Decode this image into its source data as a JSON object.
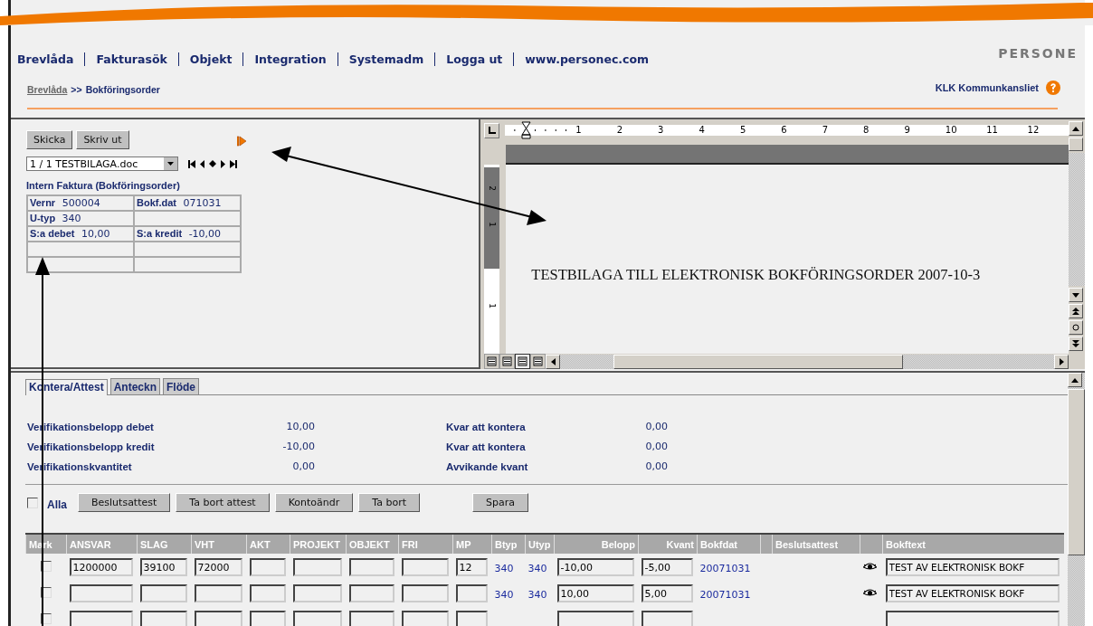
{
  "nav": [
    "Brevlåda",
    "Fakturasök",
    "Objekt",
    "Integration",
    "Systemadm",
    "Logga ut",
    "www.personec.com"
  ],
  "logo": "PERSONE",
  "breadcrumb": {
    "link": "Brevlåda",
    "separator": ">>",
    "current": "Bokföringsorder"
  },
  "organization": "KLK Kommunkansliet",
  "left_panel": {
    "buttons": [
      "Skicka",
      "Skriv ut"
    ],
    "file_select": "1 / 1 TESTBILAGA.doc",
    "title": "Intern Faktura (Bokföringsorder)",
    "grid": [
      [
        {
          "kind": "field",
          "label": "Vernr",
          "value": "500004"
        },
        {
          "kind": "field",
          "label": "Bokf.dat",
          "value": "071031"
        }
      ],
      [
        {
          "kind": "field",
          "label": "U-typ",
          "value": "340"
        },
        {
          "kind": "empty"
        }
      ],
      [
        {
          "kind": "field",
          "label": "S:a debet",
          "value": "10,00"
        },
        {
          "kind": "field",
          "label": "S:a kredit",
          "value": "-10,00"
        }
      ],
      [
        {
          "kind": "empty"
        },
        {
          "kind": "empty"
        }
      ],
      [
        {
          "kind": "empty"
        },
        {
          "kind": "empty"
        }
      ]
    ]
  },
  "document": {
    "ruler_marks": [
      "1",
      "2",
      "3",
      "4",
      "5",
      "6",
      "7",
      "8",
      "9",
      "10",
      "11",
      "12"
    ],
    "vertical_ruler_marks": [
      "2",
      "1",
      "1"
    ],
    "text": "TESTBILAGA TILL ELEKTRONISK BOKFÖRINGSORDER 2007-10-3"
  },
  "tabs": [
    {
      "label": "Kontera/Attest",
      "selected": true
    },
    {
      "label": "Anteckn",
      "selected": false
    },
    {
      "label": "Flöde",
      "selected": false
    }
  ],
  "summary": [
    {
      "label": "Verifikationsbelopp debet",
      "value": "10,00",
      "label2": "Kvar att kontera",
      "value2": "0,00"
    },
    {
      "label": "Verifikationsbelopp kredit",
      "value": "-10,00",
      "label2": "Kvar att kontera",
      "value2": "0,00"
    },
    {
      "label": "Verifikationskvantitet",
      "value": "0,00",
      "label2": "Avvikande kvant",
      "value2": "0,00"
    }
  ],
  "select_all": {
    "label": "Alla",
    "checked": false
  },
  "actions": [
    "Beslutsattest",
    "Ta bort attest",
    "Kontoändr",
    "Ta bort",
    "Spara"
  ],
  "table": {
    "columns": [
      {
        "kind": "heading",
        "label": "Mark"
      },
      {
        "kind": "heading",
        "label": "ANSVAR"
      },
      {
        "kind": "heading",
        "label": "SLAG"
      },
      {
        "kind": "heading",
        "label": "VHT"
      },
      {
        "kind": "heading",
        "label": "AKT"
      },
      {
        "kind": "heading",
        "label": "PROJEKT"
      },
      {
        "kind": "heading",
        "label": "OBJEKT"
      },
      {
        "kind": "heading",
        "label": "FRI"
      },
      {
        "kind": "heading",
        "label": "MP"
      },
      {
        "kind": "heading",
        "label": "Btyp"
      },
      {
        "kind": "heading",
        "label": "Utyp"
      },
      {
        "kind": "heading",
        "label": "Belopp"
      },
      {
        "kind": "heading",
        "label": "Kvant"
      },
      {
        "kind": "heading",
        "label": "Bokfdat"
      },
      {
        "kind": "blank"
      },
      {
        "kind": "heading",
        "label": "Beslutsattest"
      },
      {
        "kind": "blank"
      },
      {
        "kind": "heading",
        "label": "Bokftext"
      }
    ],
    "rows": [
      [
        {
          "kind": "check",
          "checked": false
        },
        {
          "kind": "input",
          "value": "1200000"
        },
        {
          "kind": "input",
          "value": "39100"
        },
        {
          "kind": "input",
          "value": "72000"
        },
        {
          "kind": "input"
        },
        {
          "kind": "input"
        },
        {
          "kind": "input"
        },
        {
          "kind": "input"
        },
        {
          "kind": "input",
          "value": "12"
        },
        {
          "kind": "text",
          "value": "340"
        },
        {
          "kind": "text",
          "value": "340"
        },
        {
          "kind": "input",
          "value": "-10,00"
        },
        {
          "kind": "input",
          "value": "-5,00"
        },
        {
          "kind": "text",
          "value": "20071031"
        },
        {
          "kind": "blank"
        },
        {
          "kind": "blank"
        },
        {
          "kind": "eye"
        },
        {
          "kind": "input",
          "value": "TEST AV ELEKTRONISK BOKF"
        }
      ],
      [
        {
          "kind": "check",
          "checked": false
        },
        {
          "kind": "input"
        },
        {
          "kind": "input"
        },
        {
          "kind": "input"
        },
        {
          "kind": "input"
        },
        {
          "kind": "input"
        },
        {
          "kind": "input"
        },
        {
          "kind": "input"
        },
        {
          "kind": "input"
        },
        {
          "kind": "text",
          "value": "340"
        },
        {
          "kind": "text",
          "value": "340"
        },
        {
          "kind": "input",
          "value": "10,00"
        },
        {
          "kind": "input",
          "value": "5,00"
        },
        {
          "kind": "text",
          "value": "20071031"
        },
        {
          "kind": "blank"
        },
        {
          "kind": "blank"
        },
        {
          "kind": "eye"
        },
        {
          "kind": "input",
          "value": "TEST AV ELEKTRONISK BOKF"
        }
      ],
      [
        {
          "kind": "check",
          "checked": false
        },
        {
          "kind": "input"
        },
        {
          "kind": "input"
        },
        {
          "kind": "input"
        },
        {
          "kind": "input"
        },
        {
          "kind": "input"
        },
        {
          "kind": "input"
        },
        {
          "kind": "input"
        },
        {
          "kind": "input"
        },
        {
          "kind": "blank"
        },
        {
          "kind": "blank"
        },
        {
          "kind": "input"
        },
        {
          "kind": "input"
        },
        {
          "kind": "blank"
        },
        {
          "kind": "blank"
        },
        {
          "kind": "blank"
        },
        {
          "kind": "blank"
        },
        {
          "kind": "input"
        }
      ]
    ]
  }
}
